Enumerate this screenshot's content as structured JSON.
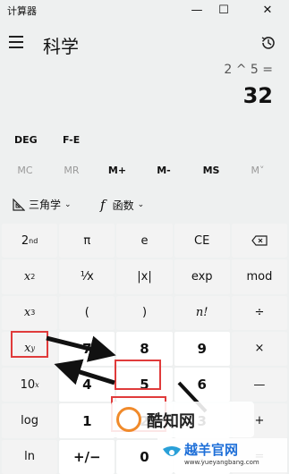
{
  "titlebar": {
    "title": "计算器",
    "minimize": "—",
    "maximize": "☐",
    "close": "✕"
  },
  "header": {
    "mode": "科学"
  },
  "display": {
    "expression": "2 ^ 5 =",
    "result": "32"
  },
  "modes": {
    "angle": "DEG",
    "fe": "F-E"
  },
  "memory": [
    "MC",
    "MR",
    "M+",
    "M-",
    "MS",
    "M˅"
  ],
  "functions": {
    "trig": "三角学",
    "func": "函数"
  },
  "keypad": {
    "second": "2",
    "second_sup": "nd",
    "pi": "π",
    "e": "e",
    "ce": "CE",
    "x2": "x",
    "x2_sup": "2",
    "reciprocal": "⅟x",
    "abs": "|x|",
    "exp": "exp",
    "mod": "mod",
    "x3": "x",
    "x3_sup": "3",
    "lparen": "(",
    "rparen": ")",
    "fact": "n!",
    "divide": "÷",
    "xy": "x",
    "xy_sup": "y",
    "seven": "7",
    "eight": "8",
    "nine": "9",
    "multiply": "×",
    "ten": "10",
    "ten_sup": "x",
    "four": "4",
    "five": "5",
    "six": "6",
    "minus": "—",
    "log": "log",
    "one": "1",
    "two": "2",
    "three": "3",
    "plus": "+",
    "ln": "ln",
    "negate": "+/−",
    "zero": "0",
    "dot": ".",
    "equals": "="
  },
  "watermark": {
    "main": "酷知网",
    "brand": "越羊官网",
    "url": "www.yueyangbang.com"
  },
  "colors": {
    "background": "#eef0f0",
    "key_function": "#f3f3f3",
    "key_number": "#ffffff",
    "annotation": "#e03b3b"
  }
}
